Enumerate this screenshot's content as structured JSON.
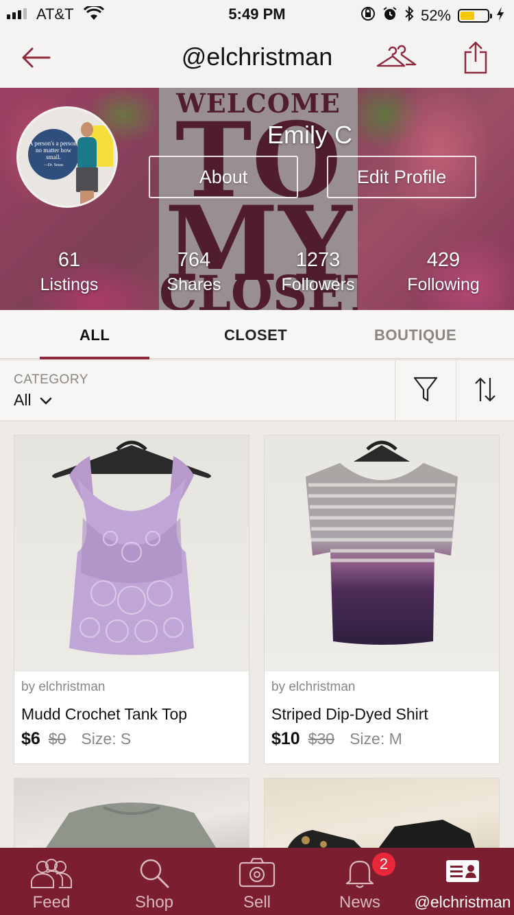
{
  "status_bar": {
    "carrier": "AT&T",
    "time": "5:49 PM",
    "battery": "52%",
    "battery_level": 0.52,
    "icons": [
      "signal-icon",
      "wifi-icon",
      "rotation-lock-icon",
      "alarm-icon",
      "bluetooth-icon",
      "battery-icon",
      "charging-icon"
    ]
  },
  "header": {
    "title": "@elchristman",
    "back_icon": "back-arrow-icon",
    "closet_icon": "hanger-icon",
    "share_icon": "share-icon"
  },
  "profile": {
    "name": "Emily C",
    "about_label": "About",
    "edit_label": "Edit Profile",
    "avatar_quote": "A person's a person, no matter how small.",
    "avatar_quote_author": "—Dr. Seuss",
    "banner_text": [
      "WELCOME",
      "TO",
      "MY",
      "CLOSET"
    ],
    "stats": [
      {
        "value": "61",
        "label": "Listings"
      },
      {
        "value": "764",
        "label": "Shares"
      },
      {
        "value": "1273",
        "label": "Followers"
      },
      {
        "value": "429",
        "label": "Following"
      }
    ]
  },
  "tabs": [
    {
      "label": "ALL",
      "active": true
    },
    {
      "label": "CLOSET",
      "active": false
    },
    {
      "label": "BOUTIQUE",
      "active": false
    }
  ],
  "filter": {
    "category_label": "CATEGORY",
    "category_value": "All",
    "filter_icon": "funnel-icon",
    "sort_icon": "sort-icon"
  },
  "listings": [
    {
      "seller": "by elchristman",
      "title": "Mudd Crochet Tank Top",
      "price": "$6",
      "original_price": "$0",
      "size": "Size: S",
      "photo": "lavender crochet tank top on black hanger"
    },
    {
      "seller": "by elchristman",
      "title": "Striped Dip-Dyed Shirt",
      "price": "$10",
      "original_price": "$30",
      "size": "Size: M",
      "photo": "grey striped dip-dyed purple shirt on black hanger"
    },
    {
      "photo": "grey t-shirt on bed"
    },
    {
      "photo": "black shoes on beige fabric"
    }
  ],
  "tab_bar": {
    "items": [
      {
        "label": "Feed",
        "icon": "people-icon"
      },
      {
        "label": "Shop",
        "icon": "search-icon"
      },
      {
        "label": "Sell",
        "icon": "camera-icon"
      },
      {
        "label": "News",
        "icon": "bell-icon"
      },
      {
        "label": "@elchristman",
        "icon": "profile-card-icon"
      }
    ],
    "news_badge": "2"
  },
  "colors": {
    "brand": "#7b1f30",
    "tab_underline": "#8e2a3c",
    "badge": "#e8273b",
    "battery": "#f2c800"
  }
}
